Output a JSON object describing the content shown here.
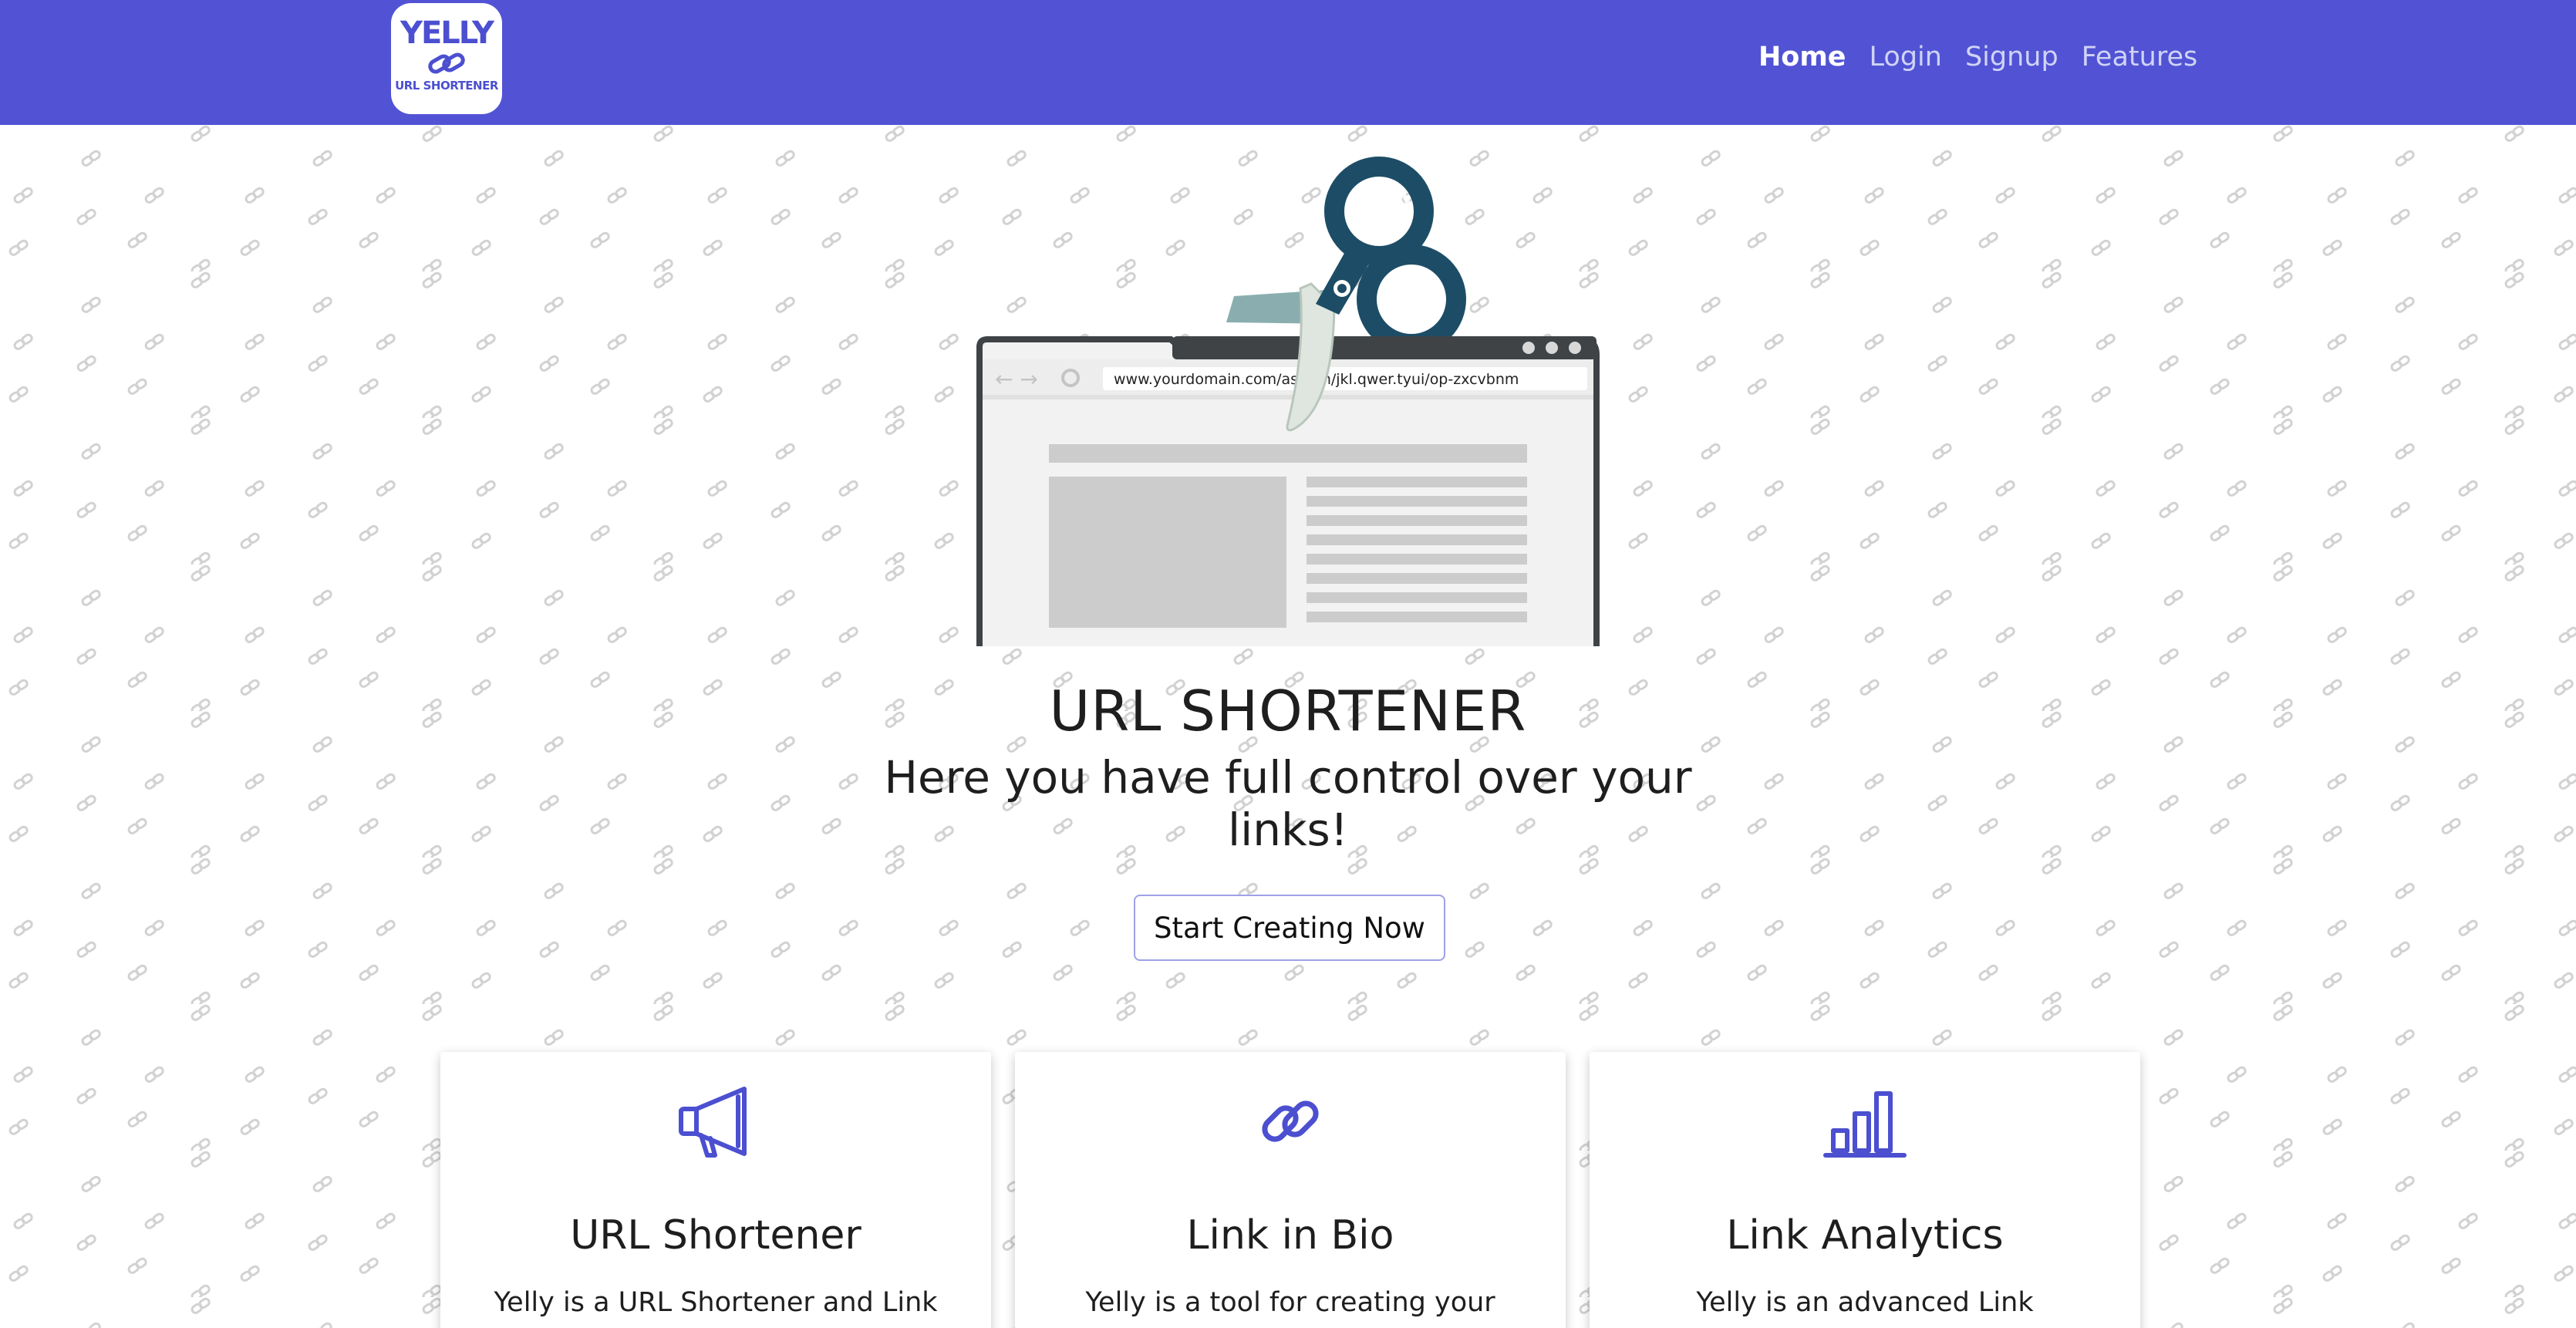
{
  "header": {
    "logo": {
      "word": "YELLY",
      "subtitle": "URL SHORTENER"
    },
    "nav": [
      {
        "label": "Home",
        "active": true
      },
      {
        "label": "Login",
        "active": false
      },
      {
        "label": "Signup",
        "active": false
      },
      {
        "label": "Features",
        "active": false
      }
    ],
    "background_color": "#5153d4"
  },
  "hero": {
    "browser_url": "www.yourdomain.com/asdfgh/jkl.qwer.tyui/op-zxcvbnm",
    "title": "URL SHORTENER",
    "subtitle": "Here you have full control over your links!",
    "cta_label": "Start Creating Now"
  },
  "cards": [
    {
      "icon": "megaphone-icon",
      "title": "URL Shortener",
      "description": "Yelly is a URL Shortener and Link"
    },
    {
      "icon": "link-icon",
      "title": "Link in Bio",
      "description": "Yelly is a tool for creating your"
    },
    {
      "icon": "bar-chart-icon",
      "title": "Link Analytics",
      "description": "Yelly is an advanced Link"
    }
  ],
  "colors": {
    "accent": "#5153d4",
    "icon": "#4b4fd0",
    "text": "#1e1e1e"
  }
}
